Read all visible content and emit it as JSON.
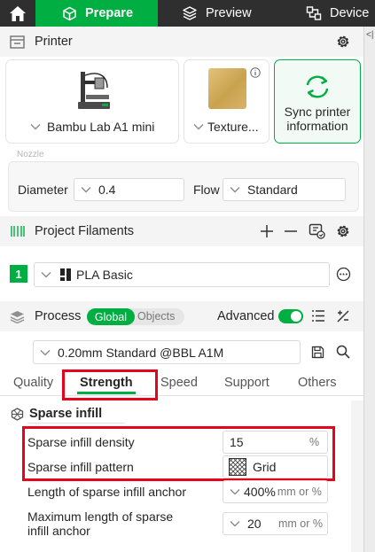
{
  "topbar": {
    "prepare_label": "Prepare",
    "preview_label": "Preview",
    "device_label": "Device"
  },
  "side_handle": "<|",
  "printer_section": {
    "title": "Printer",
    "printer_name": "Bambu Lab A1 mini",
    "plate_name": "Texture...",
    "sync_label": "Sync printer information",
    "nozzle_caption": "Nozzle",
    "diameter_label": "Diameter",
    "diameter_value": "0.4",
    "flow_label": "Flow",
    "flow_value": "Standard"
  },
  "filaments_section": {
    "title": "Project Filaments",
    "slot_number": "1",
    "filament_name": "PLA Basic",
    "slot_color": "#00ae42"
  },
  "process_section": {
    "title": "Process",
    "toggle_global": "Global",
    "toggle_objects": "Objects",
    "advanced_label": "Advanced",
    "advanced_on": true,
    "preset_name": "0.20mm Standard @BBL A1M"
  },
  "tabs": [
    "Quality",
    "Strength",
    "Speed",
    "Support",
    "Others"
  ],
  "active_tab": "Strength",
  "group": {
    "title": "Sparse infill",
    "rows": [
      {
        "label": "Sparse infill density",
        "value": "15",
        "unit": "%"
      },
      {
        "label": "Sparse infill pattern",
        "value": "Grid",
        "unit": ""
      },
      {
        "label": "Length of sparse infill anchor",
        "value": "400%",
        "unit": "mm or %"
      },
      {
        "label": "Maximum length of sparse infill anchor",
        "value": "20",
        "unit": "mm or %"
      }
    ]
  },
  "colors": {
    "accent": "#00ae42",
    "topbar": "#2f2f2f",
    "highlight": "#e4041b"
  }
}
